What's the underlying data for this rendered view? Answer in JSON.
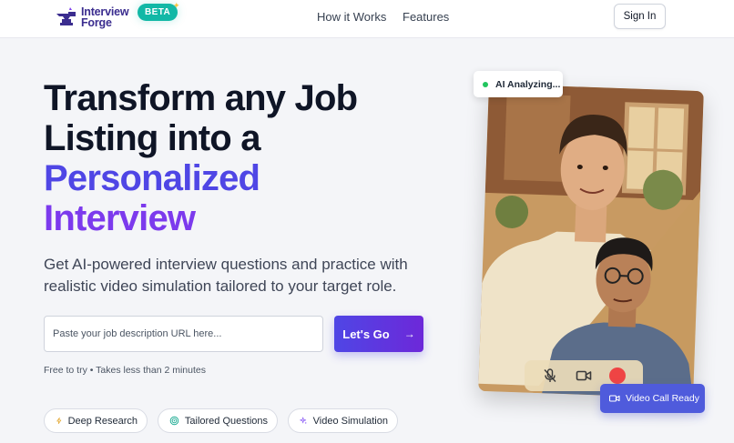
{
  "brand": {
    "name_line1": "Interview",
    "name_line2": "Forge",
    "badge": "BETA",
    "primary_color": "#4f46e5",
    "secondary_color": "#7c3aed",
    "badge_color": "#12b8a6"
  },
  "nav": {
    "links": [
      {
        "label": "How it Works"
      },
      {
        "label": "Features"
      }
    ],
    "sign_in_label": "Sign In"
  },
  "hero": {
    "headline_line1": "Transform any Job",
    "headline_line2": "Listing into a",
    "headline_line3": "Personalized",
    "headline_line4": "Interview",
    "subtitle": "Get AI-powered interview questions and practice with realistic video simulation tailored to your target role.",
    "url_input": {
      "placeholder": "Paste your job description URL here...",
      "value": ""
    },
    "cta_label": "Let's Go",
    "note": "Free to try • Takes less than 2 minutes"
  },
  "features": [
    {
      "label": "Deep Research",
      "icon": "lightning-icon"
    },
    {
      "label": "Tailored Questions",
      "icon": "target-icon"
    },
    {
      "label": "Video Simulation",
      "icon": "sparkle-icon"
    }
  ],
  "illustration": {
    "status_badge": "AI Analyzing...",
    "status_color": "#22c55e",
    "video_ready_label": "Video Call Ready",
    "controls": [
      "microphone-icon",
      "video-camera-icon",
      "end-call-icon"
    ]
  }
}
